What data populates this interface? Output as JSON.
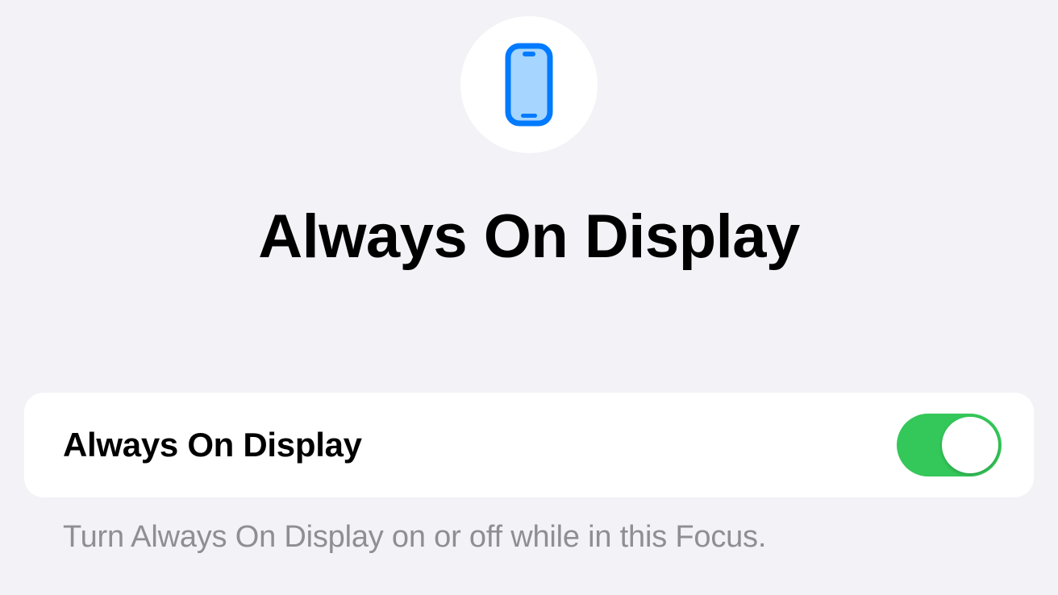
{
  "header": {
    "title": "Always On Display",
    "icon": "phone-display-icon"
  },
  "setting": {
    "label": "Always On Display",
    "enabled": true
  },
  "footer": {
    "description": "Turn Always On Display on or off while in this Focus."
  },
  "colors": {
    "accent": "#007aff",
    "toggle_on": "#34c759",
    "background": "#f2f2f7",
    "card": "#ffffff",
    "text_secondary": "#8e8e93"
  }
}
